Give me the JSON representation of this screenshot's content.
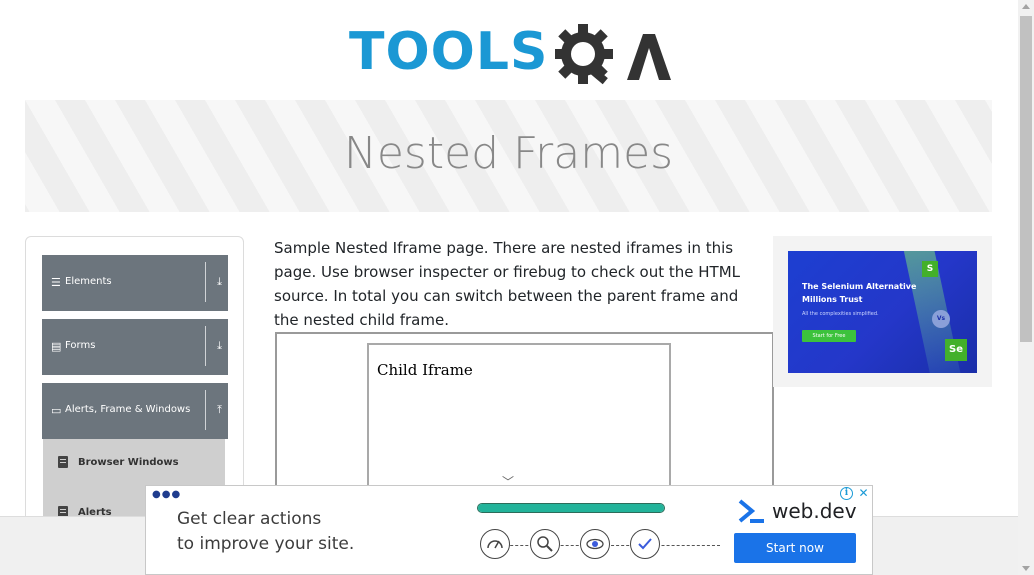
{
  "logo": {
    "text": "TOOLS",
    "suffix": "QA"
  },
  "banner": {
    "title": "Nested Frames"
  },
  "sidebar": {
    "groups": [
      {
        "label": "Elements",
        "icon": "hamburger-icon",
        "arrow": "download-icon"
      },
      {
        "label": "Forms",
        "icon": "document-icon",
        "arrow": "download-icon"
      },
      {
        "label": "Alerts, Frame & Windows",
        "icon": "window-icon",
        "arrow": "upload-icon"
      }
    ],
    "subitems": [
      {
        "label": "Browser Windows"
      },
      {
        "label": "Alerts"
      }
    ]
  },
  "content": {
    "description": "Sample Nested Iframe page. There are nested iframes in this page. Use browser inspecter or firebug to check out the HTML source. In total you can switch between the parent frame and the nested child frame.",
    "child_frame_text": "Child Iframe"
  },
  "right_ad": {
    "title": "The Selenium Alternative Millions Trust",
    "subtitle": "All the complexities simplified.",
    "button": "Start for Free",
    "vs": "Vs",
    "badge_s": "S",
    "badge_se": "Se"
  },
  "bottom_ad": {
    "text_line1": "Get clear actions",
    "text_line2": "to improve your site.",
    "brand": "web.dev",
    "button": "Start now",
    "progress": 1.0,
    "info": "i",
    "close": "✕",
    "colors": {
      "progress": "#22b39a",
      "button": "#1a73e8"
    }
  }
}
